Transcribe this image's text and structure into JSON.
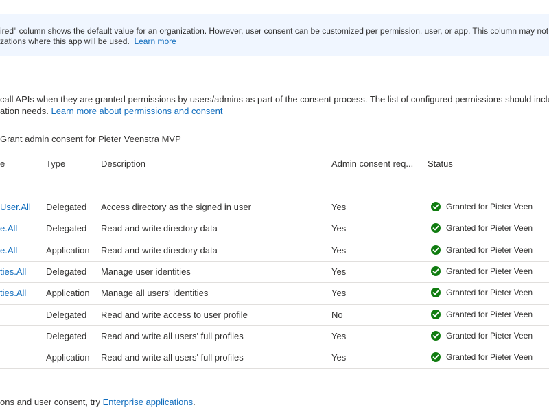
{
  "banner": {
    "line1": "ired\" column shows the default value for an organization. However, user consent can be customized per permission, user, or app. This column may not r",
    "line2": "zations where this app will be used.",
    "learn_more": "Learn more"
  },
  "intro": {
    "line1": "call APIs when they are granted permissions by users/admins as part of the consent process. The list of configured permissions should inclu",
    "line2_prefix": "ation needs.",
    "line2_link": "Learn more about permissions and consent"
  },
  "grant_admin_consent": "Grant admin consent for Pieter Veenstra MVP",
  "table": {
    "headers": {
      "name": "e",
      "type": "Type",
      "description": "Description",
      "admin_consent": "Admin consent req...",
      "status": "Status"
    },
    "rows": [
      {
        "name": "User.All",
        "type": "Delegated",
        "description": "Access directory as the signed in user",
        "admin": "Yes",
        "status": "Granted for Pieter Veen"
      },
      {
        "name": "e.All",
        "type": "Delegated",
        "description": "Read and write directory data",
        "admin": "Yes",
        "status": "Granted for Pieter Veen"
      },
      {
        "name": "e.All",
        "type": "Application",
        "description": "Read and write directory data",
        "admin": "Yes",
        "status": "Granted for Pieter Veen"
      },
      {
        "name": "ties.All",
        "type": "Delegated",
        "description": "Manage user identities",
        "admin": "Yes",
        "status": "Granted for Pieter Veen"
      },
      {
        "name": "ties.All",
        "type": "Application",
        "description": "Manage all users' identities",
        "admin": "Yes",
        "status": "Granted for Pieter Veen"
      },
      {
        "name": "",
        "type": "Delegated",
        "description": "Read and write access to user profile",
        "admin": "No",
        "status": "Granted for Pieter Veen"
      },
      {
        "name": "",
        "type": "Delegated",
        "description": "Read and write all users' full profiles",
        "admin": "Yes",
        "status": "Granted for Pieter Veen"
      },
      {
        "name": "",
        "type": "Application",
        "description": "Read and write all users' full profiles",
        "admin": "Yes",
        "status": "Granted for Pieter Veen"
      }
    ]
  },
  "footer": {
    "prefix": "ons and user consent, try",
    "link": "Enterprise applications",
    "suffix": "."
  },
  "colors": {
    "link": "#0f6cbd",
    "banner_bg": "#f0f6ff",
    "granted": "#107c10"
  }
}
